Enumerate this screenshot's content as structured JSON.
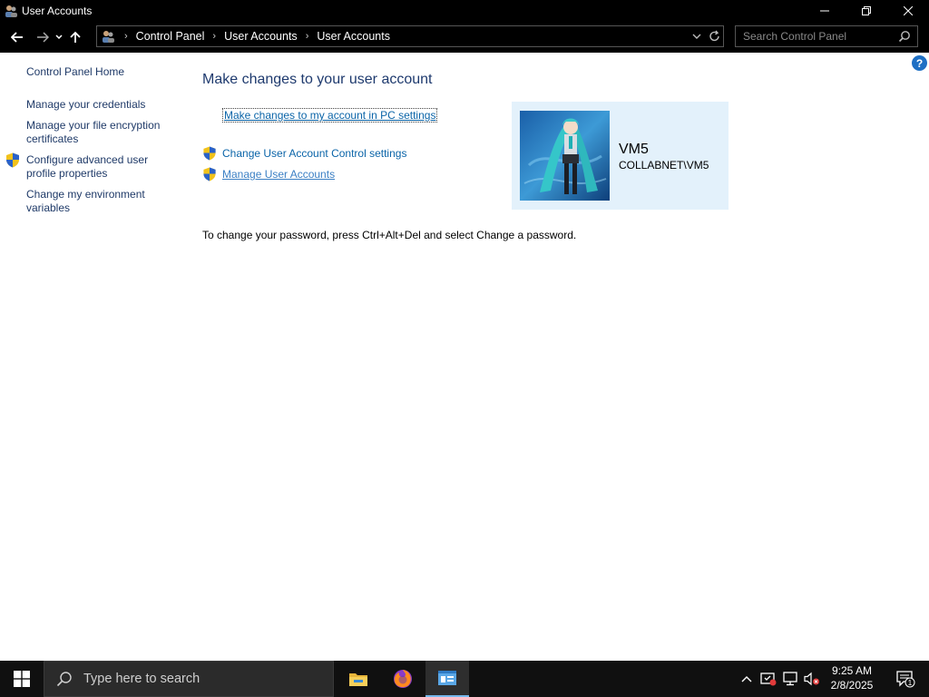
{
  "window": {
    "title": "User Accounts"
  },
  "address_bar": {
    "crumbs": [
      "Control Panel",
      "User Accounts",
      "User Accounts"
    ]
  },
  "search": {
    "placeholder": "Search Control Panel"
  },
  "sidebar": {
    "items": [
      {
        "label": "Control Panel Home"
      },
      {
        "label": "Manage your credentials"
      },
      {
        "label": "Manage your file encryption certificates"
      },
      {
        "label": "Configure advanced user profile properties"
      },
      {
        "label": "Change my environment variables"
      }
    ]
  },
  "main": {
    "heading": "Make changes to your user account",
    "pc_settings_link": "Make changes to my account in PC settings",
    "tasks": [
      {
        "label": "Change User Account Control settings"
      },
      {
        "label": "Manage User Accounts"
      }
    ],
    "password_note": "To change your password, press Ctrl+Alt+Del and select Change a password."
  },
  "account": {
    "name": "VM5",
    "domain": "COLLABNET\\VM5"
  },
  "taskbar": {
    "search_placeholder": "Type here to search",
    "time": "9:25 AM",
    "date": "2/8/2025",
    "notification_count": "1"
  },
  "colors": {
    "link": "#0a64a8",
    "heading": "#1e3a6e",
    "tile_bg": "#e3f1fb"
  }
}
